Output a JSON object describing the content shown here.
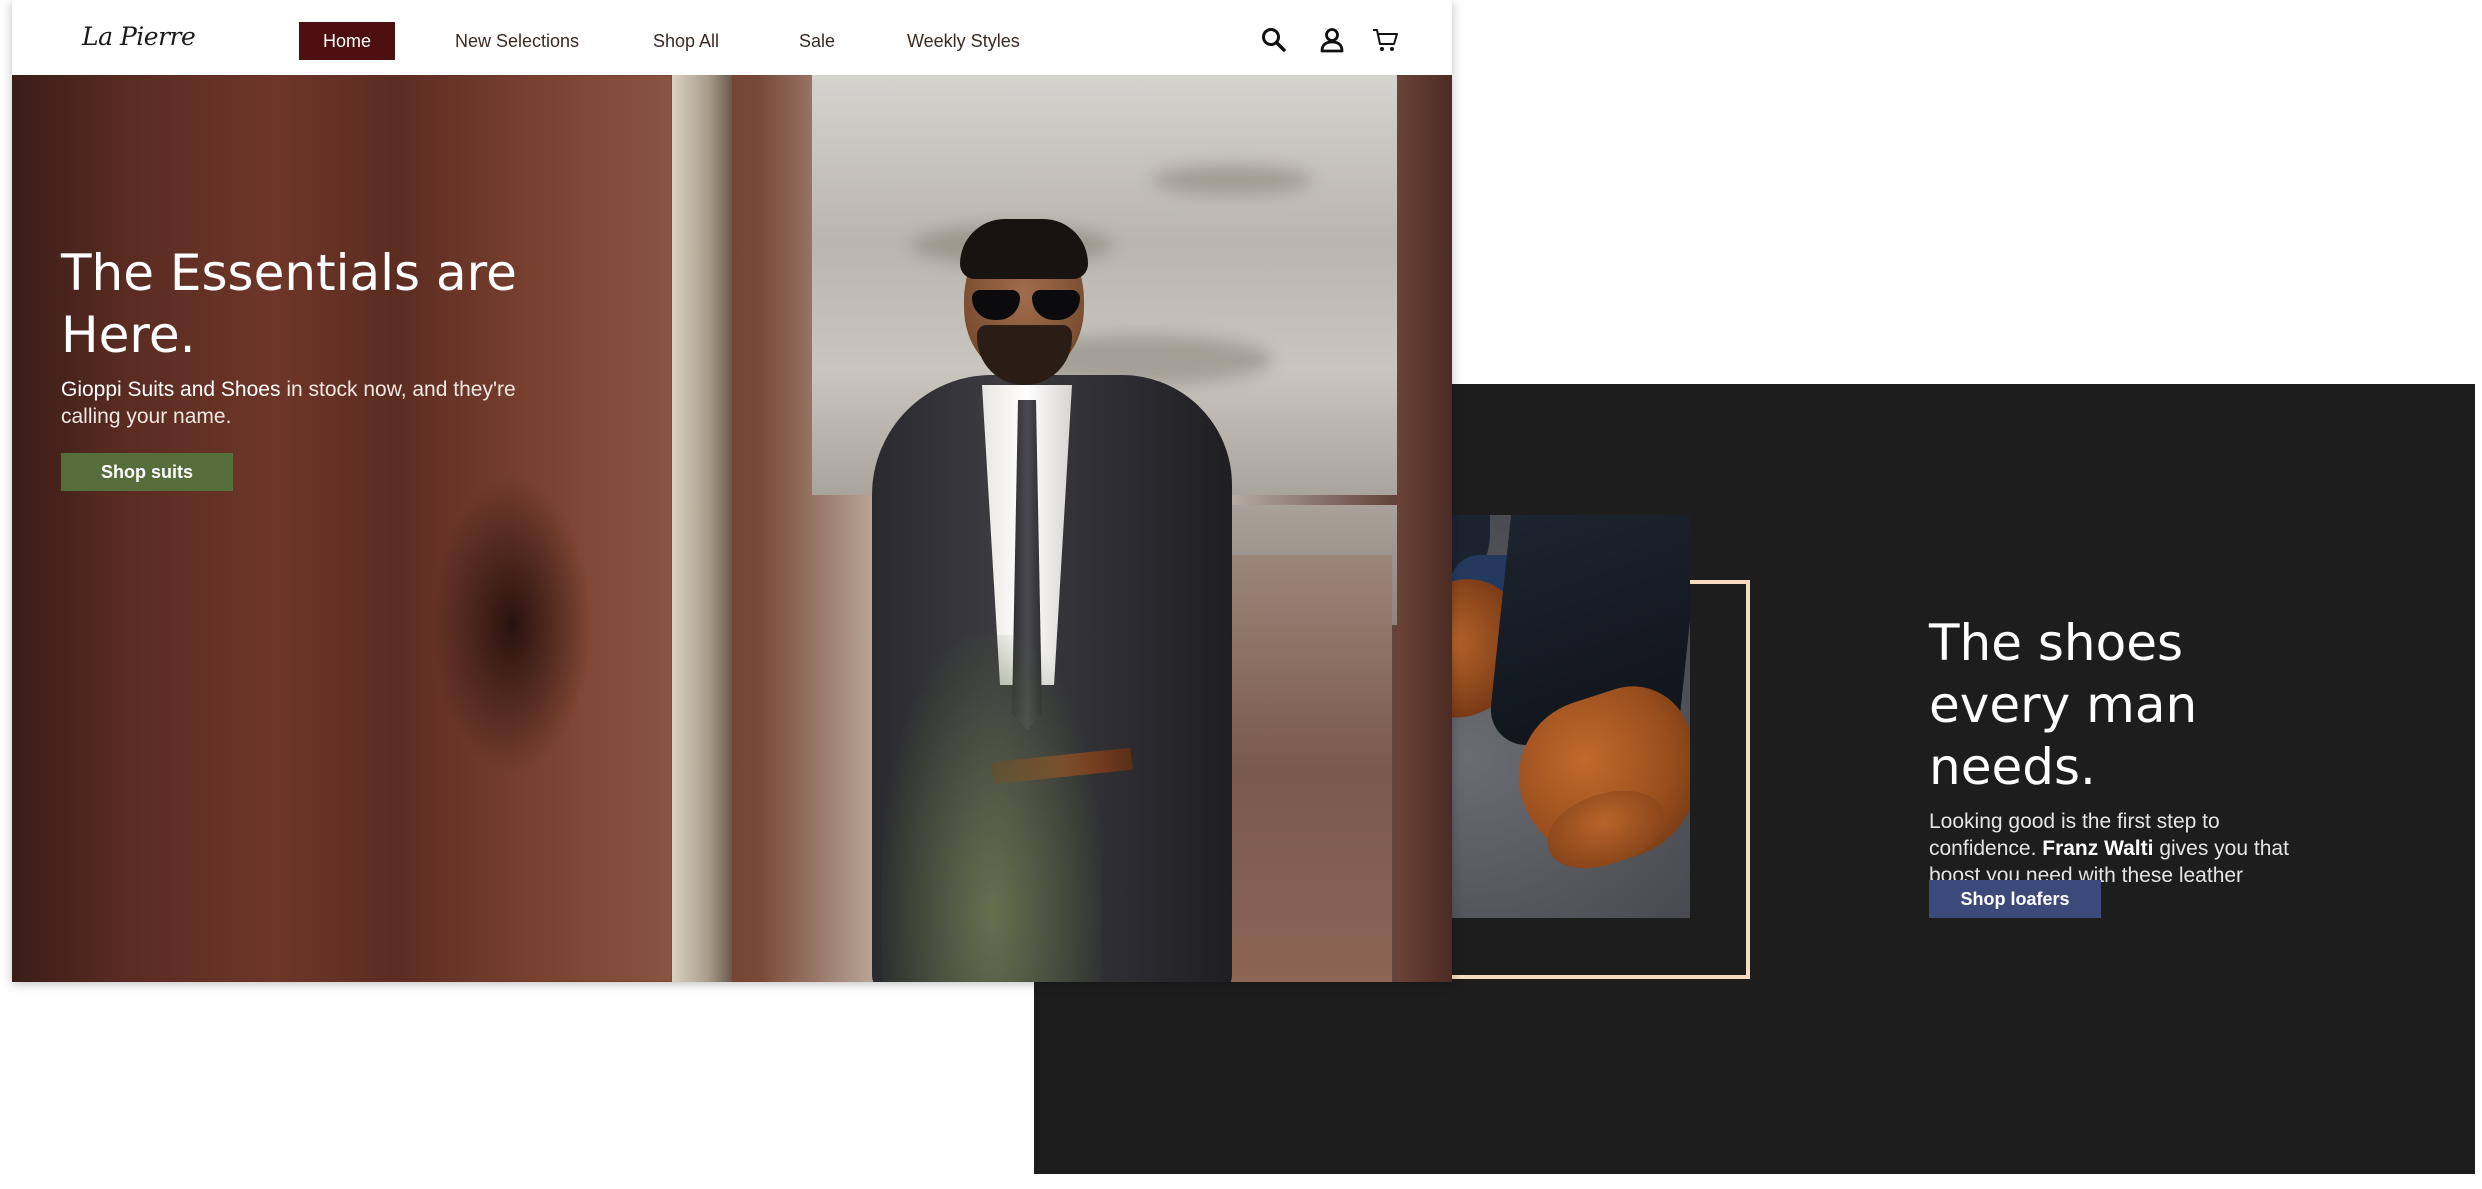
{
  "brand": {
    "logo_text": "La Pierre"
  },
  "nav": {
    "items": [
      {
        "label": "Home",
        "active": true
      },
      {
        "label": "New Selections",
        "active": false
      },
      {
        "label": "Shop All",
        "active": false
      },
      {
        "label": "Sale",
        "active": false
      },
      {
        "label": "Weekly Styles",
        "active": false
      }
    ],
    "icons": [
      "search-icon",
      "account-icon",
      "cart-icon"
    ]
  },
  "hero": {
    "heading": "The Essentials are Here.",
    "body_emphasis": "Gioppi Suits and Shoes",
    "body_text": " in stock now, and they're calling your name.",
    "button_label": "Shop suits"
  },
  "secondary": {
    "heading": "The shoes every man needs.",
    "body_before": "Looking good is the first step to confidence. ",
    "body_emphasis": "Franz Walti",
    "body_after": " gives you that boost you need with these leather loafers.",
    "button_label": "Shop loafers"
  },
  "colors": {
    "active_nav_bg": "#4d0f10",
    "suits_button_bg": "#566d3c",
    "loafers_button_bg": "#3c4a7b",
    "dark_panel_bg": "#1d1d1d",
    "frame_border": "#f5dcc0"
  }
}
